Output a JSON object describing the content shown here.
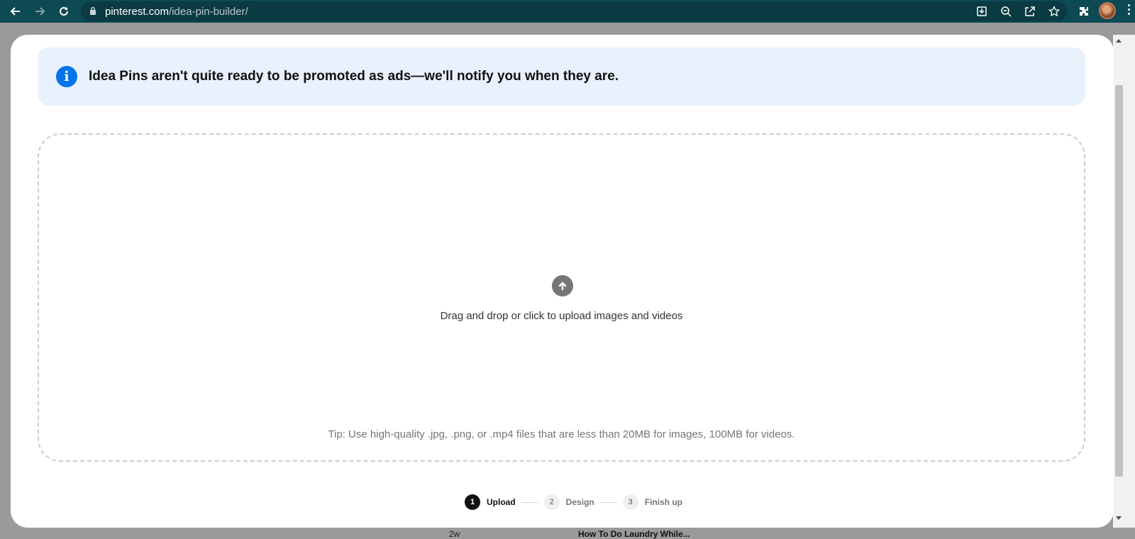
{
  "browser": {
    "url_domain": "pinterest.com",
    "url_path": "/idea-pin-builder/",
    "icons": [
      "back-icon",
      "forward-icon",
      "reload-icon",
      "lock-icon",
      "install-icon",
      "zoom-out-icon",
      "share-icon",
      "bookmark-star-icon",
      "extensions-icon",
      "profile-avatar",
      "menu-kebab-icon"
    ]
  },
  "notice": {
    "text": "Idea Pins aren't quite ready to be promoted as ads—we'll notify you when they are.",
    "background": "#e8f1fc",
    "icon_color": "#0074e8"
  },
  "dropzone": {
    "instruction": "Drag and drop or click to upload images and videos",
    "tip": "Tip: Use high-quality .jpg, .png, or .mp4 files that are less than 20MB for images, 100MB for videos."
  },
  "stepper": {
    "steps": [
      {
        "number": "1",
        "label": "Upload",
        "active": true
      },
      {
        "number": "2",
        "label": "Design",
        "active": false
      },
      {
        "number": "3",
        "label": "Finish up",
        "active": false
      }
    ]
  },
  "background_peek": {
    "time": "2w",
    "title": "How To Do Laundry While..."
  },
  "colors": {
    "toolbar": "#0d4a54",
    "overlay": "#9a9a9a",
    "active_step": "#111111"
  }
}
